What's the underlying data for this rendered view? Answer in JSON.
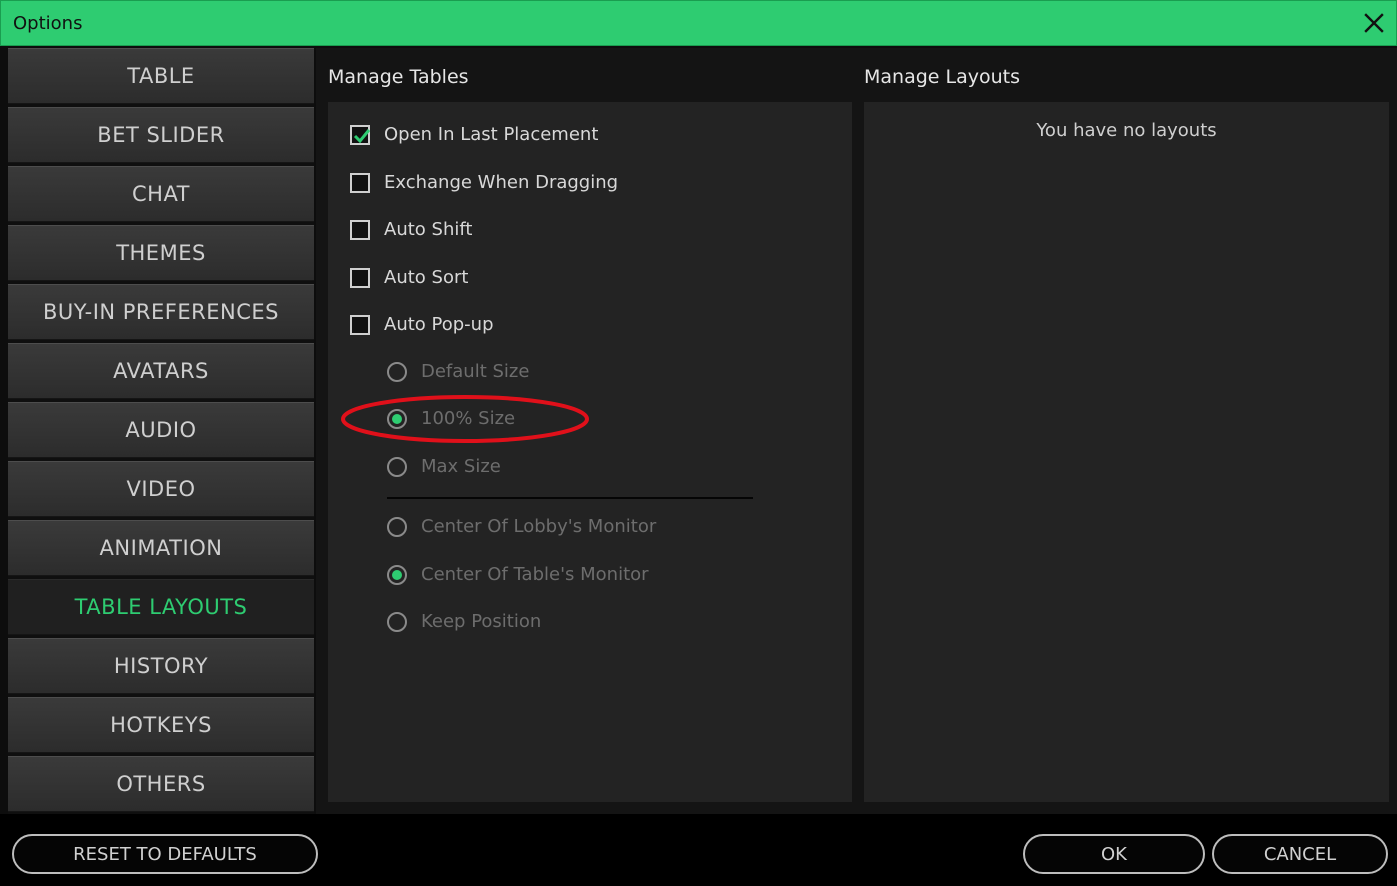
{
  "window": {
    "title": "Options"
  },
  "sidebar": {
    "items": [
      {
        "label": "TABLE"
      },
      {
        "label": "BET SLIDER"
      },
      {
        "label": "CHAT"
      },
      {
        "label": "THEMES"
      },
      {
        "label": "BUY-IN PREFERENCES"
      },
      {
        "label": "AVATARS"
      },
      {
        "label": "AUDIO"
      },
      {
        "label": "VIDEO"
      },
      {
        "label": "ANIMATION"
      },
      {
        "label": "TABLE LAYOUTS",
        "active": true
      },
      {
        "label": "HISTORY"
      },
      {
        "label": "HOTKEYS"
      },
      {
        "label": "OTHERS"
      }
    ]
  },
  "manage_tables": {
    "title": "Manage Tables",
    "checkboxes": [
      {
        "label": "Open In Last Placement",
        "checked": true
      },
      {
        "label": "Exchange When Dragging",
        "checked": false
      },
      {
        "label": "Auto Shift",
        "checked": false
      },
      {
        "label": "Auto Sort",
        "checked": false
      },
      {
        "label": "Auto Pop-up",
        "checked": false
      }
    ],
    "size_options": [
      {
        "label": "Default Size",
        "selected": false
      },
      {
        "label": "100% Size",
        "selected": true
      },
      {
        "label": "Max Size",
        "selected": false
      }
    ],
    "position_options": [
      {
        "label": "Center Of Lobby's Monitor",
        "selected": false
      },
      {
        "label": "Center Of Table's Monitor",
        "selected": true
      },
      {
        "label": "Keep Position",
        "selected": false
      }
    ]
  },
  "manage_layouts": {
    "title": "Manage Layouts",
    "empty_text": "You have no layouts"
  },
  "footer": {
    "reset_label": "RESET TO DEFAULTS",
    "ok_label": "OK",
    "cancel_label": "CANCEL"
  },
  "colors": {
    "accent": "#2ecc71",
    "annotation": "#e0101a"
  },
  "icons": {
    "close": "close-icon",
    "check": "checkmark-icon"
  }
}
